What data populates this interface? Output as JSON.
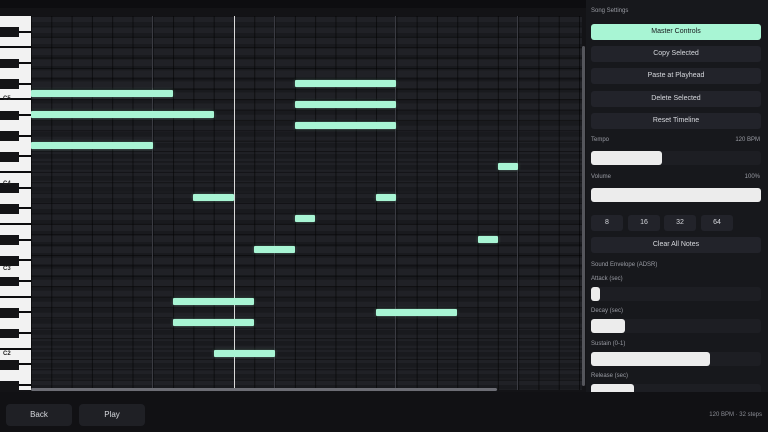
{
  "panel": {
    "title": "Song Settings",
    "buttons": [
      "Master Controls",
      "Copy Selected",
      "Paste at Playhead",
      "Delete Selected",
      "Reset Timeline"
    ],
    "tempo_label": "Tempo",
    "tempo_value": "120 BPM",
    "tempo_level": 0.42,
    "volume_label": "Volume",
    "volume_value": "100%",
    "volume_level": 1.0,
    "step_options": [
      "8",
      "16",
      "32",
      "64"
    ],
    "clear_label": "Clear All Notes",
    "envelope_title": "Sound Envelope (ADSR)",
    "attack_label": "Attack (sec)",
    "attack_level": 0.05,
    "decay_label": "Decay (sec)",
    "decay_level": 0.2,
    "sustain_label": "Sustain (0-1)",
    "sustain_level": 0.7,
    "release_label": "Release (sec)",
    "release_level": 0.25
  },
  "keys": {
    "labels": [
      "C5",
      "C4",
      "C3",
      "C2"
    ]
  },
  "roll": {
    "steps": 32,
    "playhead_step": 10,
    "notes": [
      {
        "pitch": 72,
        "start": 0,
        "length": 7
      },
      {
        "pitch": 70,
        "start": 0,
        "length": 9
      },
      {
        "pitch": 67,
        "start": 0,
        "length": 6
      },
      {
        "pitch": 73,
        "start": 13,
        "length": 5
      },
      {
        "pitch": 71,
        "start": 13,
        "length": 5
      },
      {
        "pitch": 69,
        "start": 13,
        "length": 5
      },
      {
        "pitch": 65,
        "start": 23,
        "length": 1
      },
      {
        "pitch": 62,
        "start": 8,
        "length": 2
      },
      {
        "pitch": 62,
        "start": 17,
        "length": 1
      },
      {
        "pitch": 60,
        "start": 13,
        "length": 1
      },
      {
        "pitch": 58,
        "start": 22,
        "length": 1
      },
      {
        "pitch": 57,
        "start": 11,
        "length": 2
      },
      {
        "pitch": 52,
        "start": 7,
        "length": 4
      },
      {
        "pitch": 51,
        "start": 17,
        "length": 4
      },
      {
        "pitch": 50,
        "start": 7,
        "length": 4
      },
      {
        "pitch": 47,
        "start": 9,
        "length": 3
      }
    ]
  },
  "bottom": {
    "back_label": "Back",
    "play_label": "Play",
    "status": "120 BPM · 32 steps"
  }
}
